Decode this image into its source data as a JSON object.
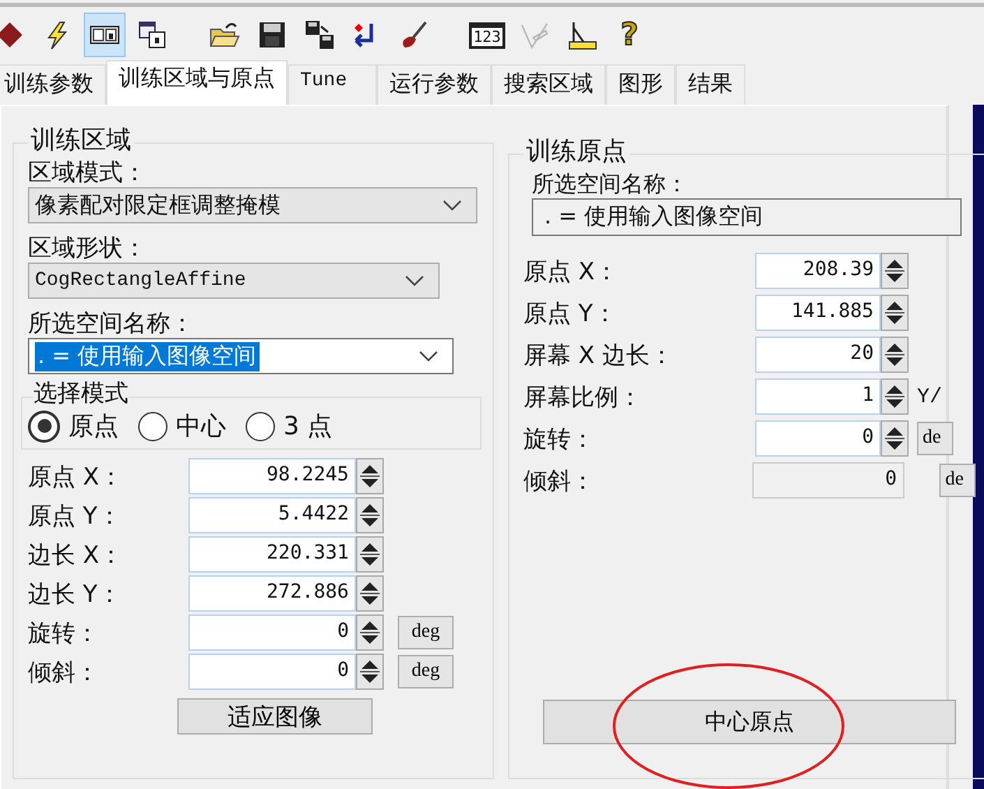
{
  "toolbar": [
    {
      "kind": "stop",
      "selected": false,
      "disabled": false
    },
    {
      "kind": "lightning",
      "selected": false,
      "disabled": false
    },
    {
      "kind": "panel",
      "selected": true,
      "disabled": false
    },
    {
      "kind": "windows",
      "selected": false,
      "disabled": false
    },
    {
      "kind": "gap"
    },
    {
      "kind": "folder",
      "selected": false,
      "disabled": false
    },
    {
      "kind": "floppy",
      "selected": false,
      "disabled": false
    },
    {
      "kind": "floppy-copy",
      "selected": false,
      "disabled": false
    },
    {
      "kind": "return",
      "selected": false,
      "disabled": false
    },
    {
      "kind": "brush",
      "selected": false,
      "disabled": false
    },
    {
      "kind": "gap"
    },
    {
      "kind": "counter",
      "label": "123",
      "selected": false,
      "disabled": false
    },
    {
      "kind": "pen",
      "selected": false,
      "disabled": true
    },
    {
      "kind": "ruler",
      "selected": false,
      "disabled": false
    },
    {
      "kind": "help",
      "label": "?",
      "selected": false,
      "disabled": false
    }
  ],
  "tabs": [
    {
      "label": "训练参数",
      "selected": false
    },
    {
      "label": "训练区域与原点",
      "selected": true
    },
    {
      "label": "Tune",
      "selected": false
    },
    {
      "label": "运行参数",
      "selected": false
    },
    {
      "label": "搜索区域",
      "selected": false
    },
    {
      "label": "图形",
      "selected": false
    },
    {
      "label": "结果",
      "selected": false
    }
  ],
  "training_region": {
    "title": "训练区域",
    "region_mode": {
      "label": "区域模式：",
      "value": "像素配对限定框调整掩模"
    },
    "region_shape": {
      "label": "区域形状：",
      "value": "CogRectangleAffine"
    },
    "space_name": {
      "label": "所选空间名称：",
      "value": ". = 使用输入图像空间",
      "highlighted": true
    },
    "select_mode": {
      "title": "选择模式",
      "options": [
        {
          "label": "原点",
          "selected": true
        },
        {
          "label": "中心",
          "selected": false
        },
        {
          "label": "3 点",
          "selected": false
        }
      ]
    },
    "fields": [
      {
        "label": "原点 X：",
        "value": "98.2245",
        "disabled": false
      },
      {
        "label": "原点 Y：",
        "value": "5.4422",
        "disabled": false
      },
      {
        "label": "边长 X：",
        "value": "220.331",
        "disabled": false
      },
      {
        "label": "边长 Y：",
        "value": "272.886",
        "disabled": false
      },
      {
        "label": "旋转：",
        "value": "0",
        "unit": "deg",
        "disabled": false
      },
      {
        "label": "倾斜：",
        "value": "0",
        "unit": "deg",
        "disabled": false
      }
    ],
    "button": "适应图像"
  },
  "training_origin": {
    "title": "训练原点",
    "space_name": {
      "label": "所选空间名称：",
      "value": ". = 使用输入图像空间"
    },
    "fields": [
      {
        "label": "原点 X：",
        "value": "208.39",
        "disabled": false
      },
      {
        "label": "原点 Y：",
        "value": "141.885",
        "disabled": false
      },
      {
        "label": "屏幕 X 边长：",
        "value": "20",
        "disabled": false
      },
      {
        "label": "屏幕比例：",
        "value": "1",
        "unit": "Y/",
        "kind": "unit-text",
        "disabled": false
      },
      {
        "label": "旋转：",
        "value": "0",
        "unit": "de",
        "kind": "unit-button",
        "disabled": false
      },
      {
        "label": "倾斜：",
        "value": "0",
        "unit": "de",
        "kind": "unit-button",
        "disabled": true
      }
    ],
    "button": "中心原点"
  }
}
